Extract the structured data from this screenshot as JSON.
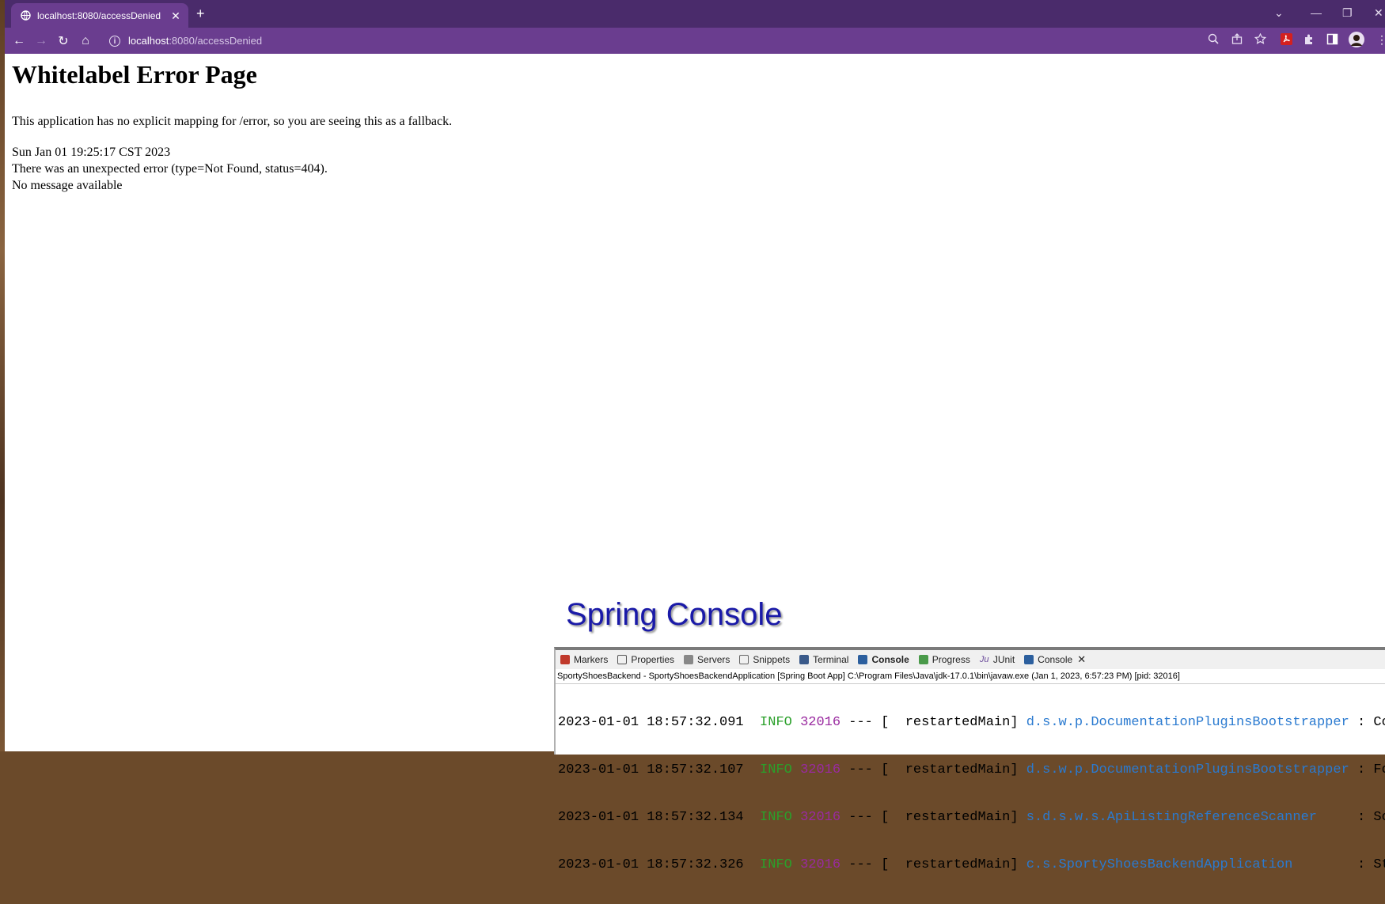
{
  "browser": {
    "tab_title": "localhost:8080/accessDenied",
    "tab_close": "✕",
    "new_tab": "+",
    "window_controls": [
      "⌄",
      "—",
      "❐",
      "✕"
    ],
    "url_host": "localhost",
    "url_path": ":8080/accessDenied",
    "nav": {
      "back": "←",
      "forward": "→",
      "reload": "↻",
      "home": "⌂"
    },
    "accent": "#6a3d8f"
  },
  "page": {
    "heading": "Whitelabel Error Page",
    "fallback_text": "This application has no explicit mapping for /error, so you are seeing this as a fallback.",
    "timestamp": "Sun Jan 01 19:25:17 CST 2023",
    "error_text": "There was an unexpected error (type=Not Found, status=404).",
    "message": "No message available"
  },
  "overlay": {
    "title": "Spring Console"
  },
  "console": {
    "tabs": [
      {
        "label": "Markers",
        "icon": "markers-icon"
      },
      {
        "label": "Properties",
        "icon": "properties-icon"
      },
      {
        "label": "Servers",
        "icon": "servers-icon"
      },
      {
        "label": "Snippets",
        "icon": "snippets-icon"
      },
      {
        "label": "Terminal",
        "icon": "terminal-icon"
      },
      {
        "label": "Console",
        "icon": "console-icon"
      },
      {
        "label": "Progress",
        "icon": "progress-icon"
      },
      {
        "label": "JUnit",
        "icon": "junit-icon"
      },
      {
        "label": "Console",
        "icon": "console-icon"
      }
    ],
    "info": "SportyShoesBackend - SportyShoesBackendApplication [Spring Boot App] C:\\Program Files\\Java\\jdk-17.0.1\\bin\\javaw.exe  (Jan 1, 2023, 6:57:23 PM) [pid: 32016]",
    "lines": [
      {
        "ts": "2023-01-01 18:57:32.091",
        "level": "INFO",
        "pid": "32016",
        "sep": " --- [  restartedMain] ",
        "cls": "d.s.w.p.DocumentationPluginsBootstrapper",
        "tail": " : Co"
      },
      {
        "ts": "2023-01-01 18:57:32.107",
        "level": "INFO",
        "pid": "32016",
        "sep": " --- [  restartedMain] ",
        "cls": "d.s.w.p.DocumentationPluginsBootstrapper",
        "tail": " : Fo"
      },
      {
        "ts": "2023-01-01 18:57:32.134",
        "level": "INFO",
        "pid": "32016",
        "sep": " --- [  restartedMain] ",
        "cls": "s.d.s.w.s.ApiListingReferenceScanner    ",
        "tail": " : Sc"
      },
      {
        "ts": "2023-01-01 18:57:32.326",
        "level": "INFO",
        "pid": "32016",
        "sep": " --- [  restartedMain] ",
        "cls": "c.s.SportyShoesBackendApplication       ",
        "tail": " : St"
      }
    ]
  }
}
